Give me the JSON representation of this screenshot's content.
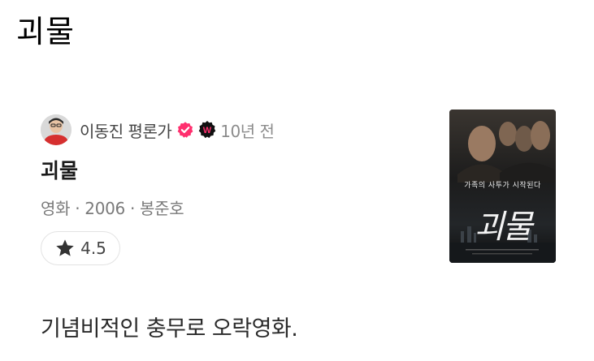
{
  "page": {
    "title": "괴물"
  },
  "author": {
    "name": "이동진 평론가",
    "avatar_icon": "person-avatar-icon",
    "verified_icon": "verified-check-icon",
    "badge_icon": "w-badge-icon",
    "time_ago": "10년 전"
  },
  "movie": {
    "title": "괴물",
    "category": "영화",
    "year": "2006",
    "director": "봉준호",
    "separator": "·",
    "poster": {
      "tagline": "가족의 사투가 시작된다",
      "logo": "괴물"
    }
  },
  "rating": {
    "icon": "star-icon",
    "value": "4.5"
  },
  "review": {
    "text": "기념비적인 충무로 오락영화."
  },
  "colors": {
    "verified": "#ff2f6e",
    "badge": "#111111",
    "badge_letter": "#ff2f6e",
    "meta_text": "#7a7a7a",
    "chip_border": "#e3e3e3"
  }
}
